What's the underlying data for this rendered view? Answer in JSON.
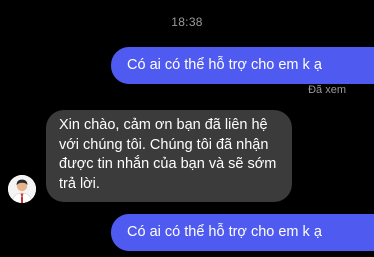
{
  "conversation": {
    "timestamp": "18:38",
    "messages": [
      {
        "direction": "outgoing",
        "text": "Có ai có thể hỗ trợ cho em k ạ"
      },
      {
        "direction": "incoming",
        "text": "Xin chào, cảm ơn bạn đã liên hệ với chúng tôi. Chúng tôi đã nhận được tin nhắn của bạn và sẽ sớm trả lời."
      },
      {
        "direction": "outgoing",
        "text": "Có ai có thể hỗ trợ cho em k ạ"
      }
    ],
    "seen_status": "Đã xem"
  },
  "colors": {
    "background": "#000000",
    "outgoing_bubble": "#4f5af0",
    "incoming_bubble": "#3b3b3b",
    "meta_text": "#9a9a9a"
  },
  "icons": {
    "sender_avatar": "avatar-icon"
  }
}
